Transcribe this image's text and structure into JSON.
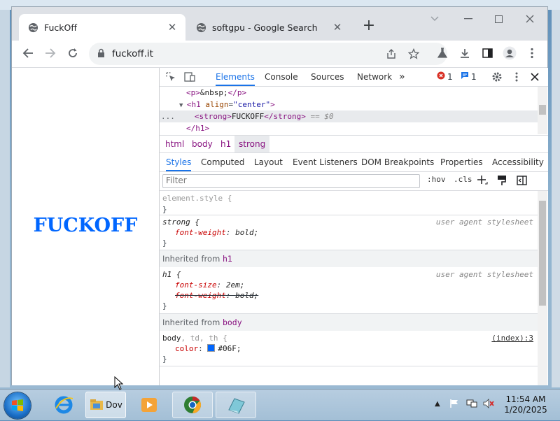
{
  "browser": {
    "tabs": [
      {
        "title": "FuckOff",
        "active": true,
        "icon": "globe-icon"
      },
      {
        "title": "softgpu - Google Search",
        "active": false,
        "icon": "globe-icon"
      }
    ],
    "new_tab_label": "+",
    "url": "fuckoff.it"
  },
  "page": {
    "heading": "FUCKOFF",
    "heading_color": "#0066ff"
  },
  "devtools": {
    "tabs": [
      "Elements",
      "Console",
      "Sources",
      "Network"
    ],
    "more": "»",
    "error_count": "1",
    "message_count": "1",
    "dom_lines": {
      "p_open": "<p>",
      "p_text": "&nbsp;",
      "p_close": "</p>",
      "h1_tag": "<h1",
      "h1_attr": "align",
      "h1_val": "\"center\"",
      "h1_end": ">",
      "strong_open": "<strong>",
      "strong_text": "FUCKOFF",
      "strong_close": "</strong>",
      "eq": " == $0",
      "h1_close": "</h1>",
      "ellipsis": "..."
    },
    "breadcrumbs": [
      "html",
      "body",
      "h1",
      "strong"
    ],
    "subtabs": [
      "Styles",
      "Computed",
      "Layout",
      "Event Listeners",
      "DOM Breakpoints",
      "Properties",
      "Accessibility"
    ],
    "filter_placeholder": "Filter",
    "hov": ":hov",
    "cls": ".cls",
    "styles": {
      "element_style": "element.style {",
      "close_brace": "}",
      "strong_selector": "strong {",
      "strong_prop": "font-weight",
      "strong_val": "bold;",
      "ua": "user agent stylesheet",
      "inherited_h1_label": "Inherited from",
      "inherited_h1_tag": "h1",
      "h1_selector": "h1 {",
      "h1_prop1": "font-size",
      "h1_val1": "2em;",
      "h1_prop2": "font-weight",
      "h1_val2": "bold;",
      "inherited_body_label": "Inherited from",
      "inherited_body_tag": "body",
      "body_selector": "body",
      "body_selector_rest": ", td, th {",
      "body_source": "(index):3",
      "body_prop": "color",
      "body_val": "#06F;",
      "swatch_color": "#0066ff"
    }
  },
  "taskbar": {
    "explorer_label": "Dov",
    "time": "11:54 AM",
    "date": "1/20/2025"
  }
}
